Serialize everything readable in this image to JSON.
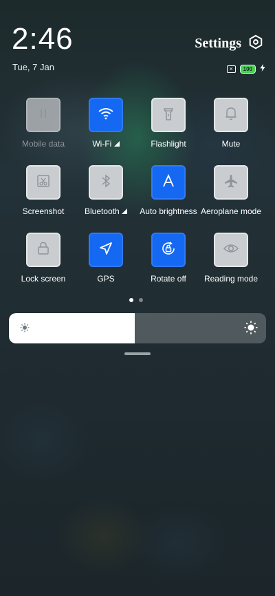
{
  "status_bar": {
    "time": "2:46",
    "date": "Tue, 7 Jan",
    "battery": "100"
  },
  "header": {
    "settings_label": "Settings"
  },
  "tiles": [
    {
      "label": "Mobile data",
      "icon": "mobile-data-icon",
      "state": "disabled"
    },
    {
      "label": "Wi-Fi",
      "icon": "wifi-icon",
      "state": "on"
    },
    {
      "label": "Flashlight",
      "icon": "flashlight-icon",
      "state": "off"
    },
    {
      "label": "Mute",
      "icon": "bell-icon",
      "state": "off"
    },
    {
      "label": "Screenshot",
      "icon": "screenshot-icon",
      "state": "off"
    },
    {
      "label": "Bluetooth",
      "icon": "bluetooth-icon",
      "state": "off"
    },
    {
      "label": "Auto brightness",
      "icon": "auto-brightness-icon",
      "state": "on"
    },
    {
      "label": "Aeroplane mode",
      "icon": "airplane-icon",
      "state": "off"
    },
    {
      "label": "Lock screen",
      "icon": "lock-icon",
      "state": "off"
    },
    {
      "label": "GPS",
      "icon": "location-arrow-icon",
      "state": "on"
    },
    {
      "label": "Rotate off",
      "icon": "rotation-lock-icon",
      "state": "on"
    },
    {
      "label": "Reading mode",
      "icon": "eye-icon",
      "state": "off"
    }
  ],
  "pager": {
    "pages": 2,
    "current": 1
  },
  "brightness": {
    "level": 0.49
  },
  "colors": {
    "accent": "#1468f2",
    "tile_off": "#c9cdd0",
    "battery": "#4ccf54"
  }
}
